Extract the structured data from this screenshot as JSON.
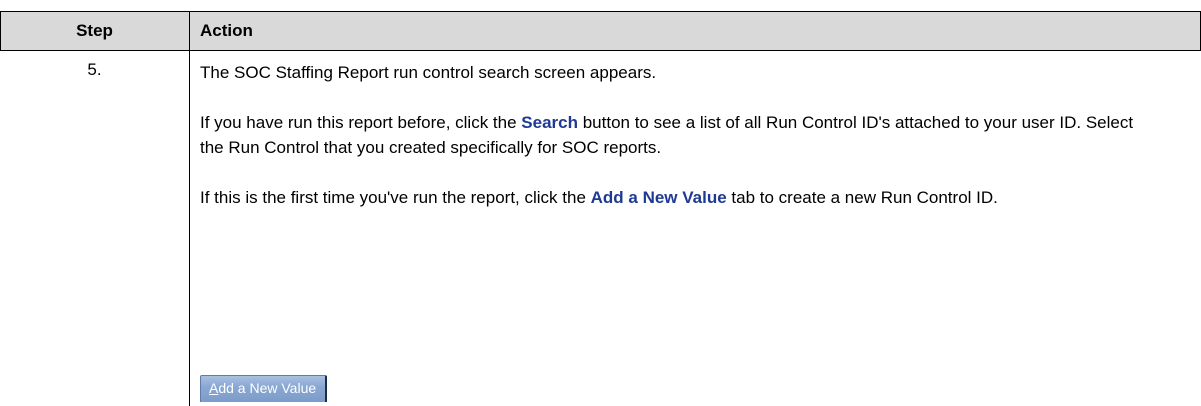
{
  "table": {
    "header": {
      "step": "Step",
      "action": "Action"
    },
    "rows": [
      {
        "step": "5.",
        "paragraphs": {
          "p1": "The SOC Staffing Report run control search screen appears.",
          "p2_before": "If you have run this report before, click the ",
          "p2_keyword": "Search",
          "p2_after": " button to see a list of all Run Control ID's attached to your user ID.  Select the Run Control that you created specifically for SOC reports.",
          "p3_before": "If this is the first time you've run the report, click the ",
          "p3_keyword": "Add a New Value",
          "p3_after": " tab to create a new Run Control ID."
        },
        "tab_button": {
          "accesskey_letter": "A",
          "label_rest": "dd a New Value"
        }
      }
    ]
  },
  "colors": {
    "keyword": "#1f3a93",
    "header_bg": "#d9d9d9",
    "tab_bg": "#8aa8d3"
  }
}
